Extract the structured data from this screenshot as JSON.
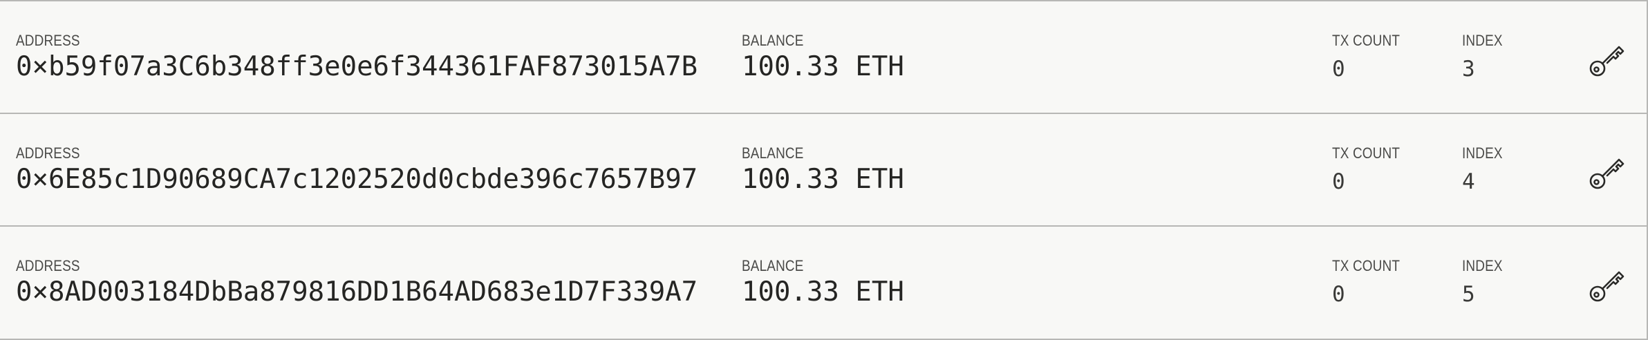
{
  "labels": {
    "address": "ADDRESS",
    "balance": "BALANCE",
    "tx_count": "TX COUNT",
    "index": "INDEX"
  },
  "accounts": [
    {
      "address": "0×b59f07a3C6b348ff3e0e6f344361FAF873015A7B",
      "balance": "100.33 ETH",
      "tx_count": "0",
      "index": "3"
    },
    {
      "address": "0×6E85c1D90689CA7c1202520d0cbde396c7657B97",
      "balance": "100.33 ETH",
      "tx_count": "0",
      "index": "4"
    },
    {
      "address": "0×8AD003184DbBa879816DD1B64AD683e1D7F339A7",
      "balance": "100.33 ETH",
      "tx_count": "0",
      "index": "5"
    }
  ],
  "icons": {
    "show_key": "key-icon"
  },
  "colors": {
    "row_bg": "#f8f8f6",
    "border": "#b7b7b5",
    "text": "#252523",
    "label": "#4a4a48"
  }
}
